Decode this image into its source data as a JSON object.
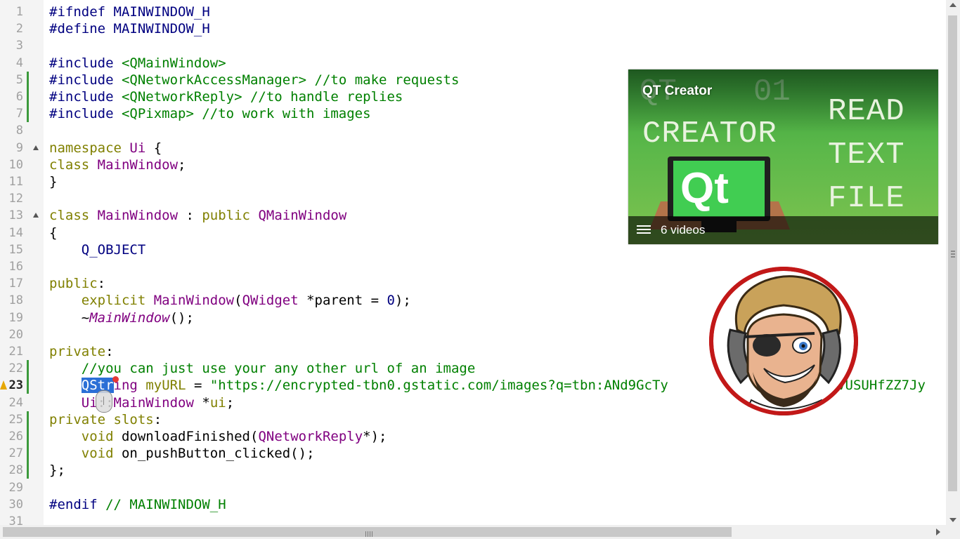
{
  "editor": {
    "lines": [
      {
        "n": "1",
        "code": [
          {
            "t": "#ifndef MAINWINDOW_H",
            "c": "pre"
          }
        ]
      },
      {
        "n": "2",
        "code": [
          {
            "t": "#define MAINWINDOW_H",
            "c": "pre"
          }
        ]
      },
      {
        "n": "3",
        "code": []
      },
      {
        "n": "4",
        "code": [
          {
            "t": "#include ",
            "c": "pre"
          },
          {
            "t": "<QMainWindow>",
            "c": "com"
          }
        ]
      },
      {
        "n": "5",
        "mark": true,
        "code": [
          {
            "t": "#include ",
            "c": "pre"
          },
          {
            "t": "<QNetworkAccessManager>",
            "c": "com"
          },
          {
            "t": " //to make requests",
            "c": "com"
          }
        ]
      },
      {
        "n": "6",
        "mark": true,
        "code": [
          {
            "t": "#include ",
            "c": "pre"
          },
          {
            "t": "<QNetworkReply>",
            "c": "com"
          },
          {
            "t": " //to handle replies",
            "c": "com"
          }
        ]
      },
      {
        "n": "7",
        "mark": true,
        "code": [
          {
            "t": "#include ",
            "c": "pre"
          },
          {
            "t": "<QPixmap>",
            "c": "com"
          },
          {
            "t": " //to work with images",
            "c": "com"
          }
        ]
      },
      {
        "n": "8",
        "code": []
      },
      {
        "n": "9",
        "fold": true,
        "code": [
          {
            "t": "namespace ",
            "c": "kw"
          },
          {
            "t": "Ui",
            "c": "ty"
          },
          {
            "t": " {",
            "c": ""
          }
        ]
      },
      {
        "n": "10",
        "code": [
          {
            "t": "class ",
            "c": "kw"
          },
          {
            "t": "MainWindow",
            "c": "ty"
          },
          {
            "t": ";",
            "c": ""
          }
        ]
      },
      {
        "n": "11",
        "code": [
          {
            "t": "}",
            "c": ""
          }
        ]
      },
      {
        "n": "12",
        "code": []
      },
      {
        "n": "13",
        "fold": true,
        "code": [
          {
            "t": "class ",
            "c": "kw"
          },
          {
            "t": "MainWindow",
            "c": "ty"
          },
          {
            "t": " : ",
            "c": ""
          },
          {
            "t": "public ",
            "c": "kw"
          },
          {
            "t": "QMainWindow",
            "c": "ty"
          }
        ]
      },
      {
        "n": "14",
        "code": [
          {
            "t": "{",
            "c": ""
          }
        ]
      },
      {
        "n": "15",
        "code": [
          {
            "t": "    ",
            "c": ""
          },
          {
            "t": "Q_OBJECT",
            "c": "mac"
          }
        ]
      },
      {
        "n": "16",
        "code": []
      },
      {
        "n": "17",
        "code": [
          {
            "t": "public",
            "c": "kw"
          },
          {
            "t": ":",
            "c": ""
          }
        ]
      },
      {
        "n": "18",
        "code": [
          {
            "t": "    ",
            "c": ""
          },
          {
            "t": "explicit ",
            "c": "kw"
          },
          {
            "t": "MainWindow",
            "c": "ty"
          },
          {
            "t": "(",
            "c": ""
          },
          {
            "t": "QWidget",
            "c": "ty"
          },
          {
            "t": " *parent = ",
            "c": ""
          },
          {
            "t": "0",
            "c": "num"
          },
          {
            "t": ");",
            "c": ""
          }
        ]
      },
      {
        "n": "19",
        "code": [
          {
            "t": "    ~",
            "c": ""
          },
          {
            "t": "MainWindow",
            "c": "it"
          },
          {
            "t": "();",
            "c": ""
          }
        ]
      },
      {
        "n": "20",
        "code": []
      },
      {
        "n": "21",
        "code": [
          {
            "t": "private",
            "c": "kw"
          },
          {
            "t": ":",
            "c": ""
          }
        ]
      },
      {
        "n": "22",
        "mark": true,
        "code": [
          {
            "t": "    ",
            "c": ""
          },
          {
            "t": "//you can just use your any other url of an image",
            "c": "com"
          }
        ]
      },
      {
        "n": "23",
        "current": true,
        "warn": true,
        "mark": true,
        "code": [
          {
            "t": "    ",
            "c": ""
          },
          {
            "t": "QStr",
            "c": "sel"
          },
          {
            "t": "ing",
            "c": "ty"
          },
          {
            "t": " ",
            "c": ""
          },
          {
            "t": "myURL",
            "c": "kw"
          },
          {
            "t": " = ",
            "c": ""
          },
          {
            "t": "\"https://encrypted-tbn0.gstatic.com/images?q=tbn:ANd9GcTy",
            "c": "str"
          },
          {
            "t": "                    ",
            "c": ""
          },
          {
            "t": "6vUSUHfZZ7Jy",
            "c": "str"
          }
        ]
      },
      {
        "n": "24",
        "code": [
          {
            "t": "    ",
            "c": ""
          },
          {
            "t": "Ui",
            "c": "ty"
          },
          {
            "t": "::",
            "c": ""
          },
          {
            "t": "MainWindow",
            "c": "ty"
          },
          {
            "t": " *",
            "c": ""
          },
          {
            "t": "ui",
            "c": "kw"
          },
          {
            "t": ";",
            "c": ""
          }
        ]
      },
      {
        "n": "25",
        "mark": true,
        "code": [
          {
            "t": "private slots",
            "c": "kw"
          },
          {
            "t": ":",
            "c": ""
          }
        ]
      },
      {
        "n": "26",
        "mark": true,
        "code": [
          {
            "t": "    ",
            "c": ""
          },
          {
            "t": "void ",
            "c": "kw"
          },
          {
            "t": "downloadFinished(",
            "c": ""
          },
          {
            "t": "QNetworkReply",
            "c": "ty"
          },
          {
            "t": "*);",
            "c": ""
          }
        ]
      },
      {
        "n": "27",
        "mark": true,
        "code": [
          {
            "t": "    ",
            "c": ""
          },
          {
            "t": "void ",
            "c": "kw"
          },
          {
            "t": "on_pushButton_clicked();",
            "c": ""
          }
        ]
      },
      {
        "n": "28",
        "mark": true,
        "code": [
          {
            "t": "};",
            "c": ""
          }
        ]
      },
      {
        "n": "29",
        "code": []
      },
      {
        "n": "30",
        "code": [
          {
            "t": "#endif ",
            "c": "pre"
          },
          {
            "t": "// MAINWINDOW_H",
            "c": "com"
          }
        ]
      },
      {
        "n": "31",
        "code": []
      }
    ]
  },
  "card": {
    "title": "QT Creator",
    "ghost_left": "QT",
    "ghost_right": "01",
    "big_left": "CREATOR",
    "big_right_1": "READ",
    "big_right_2": "TEXT",
    "big_right_3": "FILE",
    "logo": "Qt",
    "video_count": "6 videos",
    "icon": "playlist-icon"
  },
  "avatar": {
    "icon": "channel-avatar",
    "ring_color": "#c21818"
  },
  "colors": {
    "selection": "#2b6fd6",
    "gutter_mark": "#3c9a3c",
    "card_green": "#5bb84a"
  }
}
